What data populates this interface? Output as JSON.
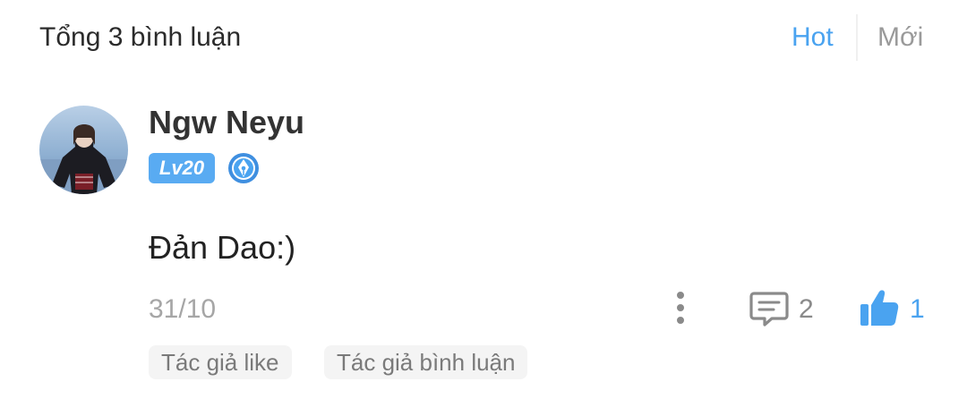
{
  "header": {
    "total_label": "Tổng 3 bình luận",
    "sort_tabs": [
      {
        "label": "Hot",
        "active": true
      },
      {
        "label": "Mới",
        "active": false
      }
    ]
  },
  "comment": {
    "username": "Ngw Neyu",
    "level": "Lv20",
    "verified_icon": "blue-pen-badge",
    "text": "Đản Dao:)",
    "date": "31/10",
    "reply_count": "2",
    "like_count": "1",
    "liked": true,
    "tags": [
      "Tác giả like",
      "Tác giả bình luận"
    ]
  },
  "colors": {
    "accent": "#4aa3f0",
    "level_badge": "#59abf2",
    "muted_text": "#a6a6a6",
    "tag_bg": "#f4f4f4"
  }
}
